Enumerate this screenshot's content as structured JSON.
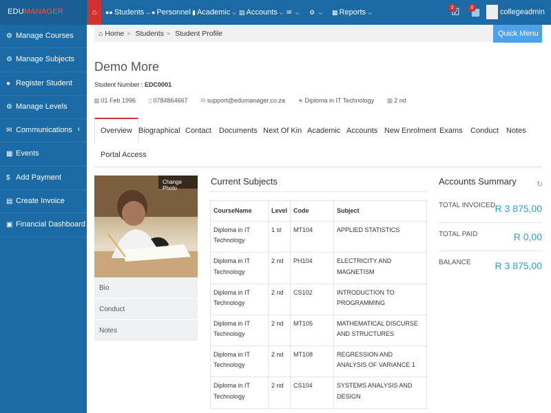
{
  "app": {
    "logo_a": "EDU",
    "logo_b": "MANAGER"
  },
  "topnav": {
    "home_icon": "home-icon",
    "items": [
      {
        "icon": "users-icon",
        "label": "Students"
      },
      {
        "icon": "user-icon",
        "label": "Personnel"
      },
      {
        "icon": "book-icon",
        "label": "Academic"
      },
      {
        "icon": "money-icon",
        "label": "Accounts"
      },
      {
        "icon": "envelope-icon",
        "label": ""
      },
      {
        "icon": "cogs-icon",
        "label": ""
      },
      {
        "icon": "report-icon",
        "label": "Reports"
      }
    ],
    "notif1_count": "3",
    "notif2_count": "0",
    "username": "collegeadmin"
  },
  "sidebar": {
    "items": [
      {
        "icon": "cogs-icon",
        "label": "Manage Courses"
      },
      {
        "icon": "cogs-icon",
        "label": "Manage Subjects"
      },
      {
        "icon": "users-icon",
        "label": "Register Student"
      },
      {
        "icon": "cogs-icon",
        "label": "Manage Levels"
      },
      {
        "icon": "envelope-icon",
        "label": "Communications"
      },
      {
        "icon": "calendar-icon",
        "label": "Events"
      },
      {
        "icon": "dollar-icon",
        "label": "Add Payment"
      },
      {
        "icon": "invoice-icon",
        "label": "Create Invoice"
      },
      {
        "icon": "dashboard-icon",
        "label": "Financial Dashboard"
      }
    ]
  },
  "breadcrumb": [
    "Home",
    "Students",
    "Student Profile"
  ],
  "quick_menu": "Quick Menu",
  "student": {
    "name": "Demo More",
    "number_label": "Student Number : ",
    "number": "EDC0001",
    "dob": "01 Feb 1996",
    "phone": "0784864667",
    "email": "support@edumanager.co.za",
    "course": "Diploma in IT Technology",
    "level": "2 nd"
  },
  "tabs": [
    "Overview",
    "Biographical",
    "Contact",
    "Documents",
    "Next Of Kin",
    "Academic",
    "Accounts",
    "New Enrolment",
    "Exams",
    "Conduct",
    "Notes",
    "Portal Access"
  ],
  "photo": {
    "change_label": "Change Photo"
  },
  "side_list": [
    "Bio",
    "Conduct",
    "Notes"
  ],
  "subjects": {
    "title": "Current Subjects",
    "columns": [
      "CourseName",
      "Level",
      "Code",
      "Subject"
    ],
    "rows": [
      [
        "Diploma in IT Technology",
        "1 st",
        "MT104",
        "APPLIED STATISTICS"
      ],
      [
        "Diploma in IT Technology",
        "2 nd",
        "PH104",
        "ELECTRICITY AND MAGNETISM"
      ],
      [
        "Diploma in IT Technology",
        "2 nd",
        "CS102",
        "INTRODUCTION TO PROGRAMMING"
      ],
      [
        "Diploma in IT Technology",
        "2 nd",
        "MT105",
        "MATHEMATICAL DISCURSE AND STRUCTURES"
      ],
      [
        "Diploma in IT Technology",
        "2 nd",
        "MT108",
        "REGRESSION AND ANALYSIS OF VARIANCE 1"
      ],
      [
        "Diploma in IT Technology",
        "2 nd",
        "CS104",
        "SYSTEMS ANALYSIS AND DESIGN"
      ]
    ]
  },
  "accounts": {
    "title": "Accounts Summary",
    "rows": [
      {
        "label": "TOTAL INVOICED",
        "value": "R 3 875,00"
      },
      {
        "label": "TOTAL PAID",
        "value": "R 0,00"
      },
      {
        "label": "BALANCE",
        "value": "R 3 875,00"
      }
    ]
  }
}
